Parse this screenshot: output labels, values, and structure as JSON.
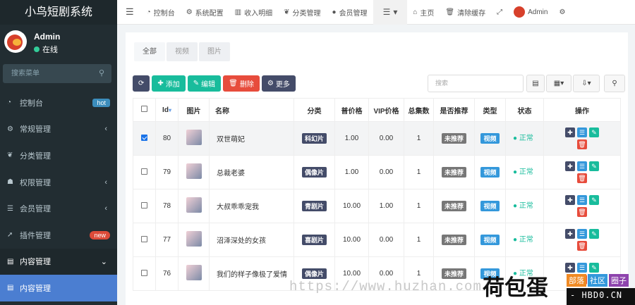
{
  "sidebar": {
    "logo": "小鸟短剧系统",
    "user_name": "Admin",
    "user_status": "在线",
    "search_placeholder": "搜索菜单",
    "items": [
      {
        "label": "控制台",
        "icon": "dashboard-icon",
        "badge": "hot"
      },
      {
        "label": "常规管理",
        "icon": "cogs-icon",
        "arrow": "‹"
      },
      {
        "label": "分类管理",
        "icon": "leaf-icon"
      },
      {
        "label": "权限管理",
        "icon": "group-icon",
        "arrow": "‹"
      },
      {
        "label": "会员管理",
        "icon": "list-icon",
        "arrow": "‹"
      },
      {
        "label": "插件管理",
        "icon": "rocket-icon",
        "badge": "new"
      },
      {
        "label": "内容管理",
        "icon": "file-icon",
        "arrow": "⌄"
      },
      {
        "label": "内容管理",
        "icon": "file-icon"
      }
    ]
  },
  "topbar": {
    "nav": [
      {
        "label": "控制台",
        "icon": "dashboard-icon"
      },
      {
        "label": "系统配置",
        "icon": "gear-icon"
      },
      {
        "label": "收入明细",
        "icon": "bar-chart-icon"
      },
      {
        "label": "分类管理",
        "icon": "leaf-icon"
      },
      {
        "label": "会员管理",
        "icon": "user-icon"
      }
    ],
    "home": "主页",
    "clear_cache": "清除缓存",
    "user": "Admin"
  },
  "tabs": [
    "全部",
    "视频",
    "图片"
  ],
  "toolbar": {
    "add": "添加",
    "edit": "编辑",
    "delete": "删除",
    "more": "更多",
    "search_placeholder": "搜索"
  },
  "table": {
    "headers": [
      "Id",
      "图片",
      "名称",
      "分类",
      "普价格",
      "VIP价格",
      "总集数",
      "是否推荐",
      "类型",
      "状态",
      "操作"
    ],
    "rows": [
      {
        "id": "80",
        "name": "双世萌妃",
        "category": "科幻片",
        "price": "1.00",
        "vip": "0.00",
        "episodes": "1",
        "recommend": "未推荐",
        "type": "视频",
        "status": "● 正常",
        "selected": true
      },
      {
        "id": "79",
        "name": "总裁老婆",
        "category": "偶像片",
        "price": "1.00",
        "vip": "0.00",
        "episodes": "1",
        "recommend": "未推荐",
        "type": "视频",
        "status": "● 正常",
        "selected": false
      },
      {
        "id": "78",
        "name": "大叔乖乖宠我",
        "category": "青剧片",
        "price": "10.00",
        "vip": "1.00",
        "episodes": "1",
        "recommend": "未推荐",
        "type": "视频",
        "status": "● 正常",
        "selected": false
      },
      {
        "id": "77",
        "name": "沼泽深处的女孩",
        "category": "喜剧片",
        "price": "10.00",
        "vip": "0.00",
        "episodes": "1",
        "recommend": "未推荐",
        "type": "视频",
        "status": "● 正常",
        "selected": false
      },
      {
        "id": "76",
        "name": "我们的样子像极了爱情",
        "category": "偶像片",
        "price": "10.00",
        "vip": "0.00",
        "episodes": "1",
        "recommend": "未推荐",
        "type": "视频",
        "status": "● 正常",
        "selected": false
      }
    ]
  },
  "watermark": {
    "url": "https://www.huzhan.com/",
    "brand": "荷包蛋",
    "tags": [
      "部落",
      "社区",
      "圈子"
    ],
    "tag_colors": [
      "#f08a24",
      "#3498db",
      "#8e44ad"
    ],
    "domain": "- HBD0.CN -"
  }
}
